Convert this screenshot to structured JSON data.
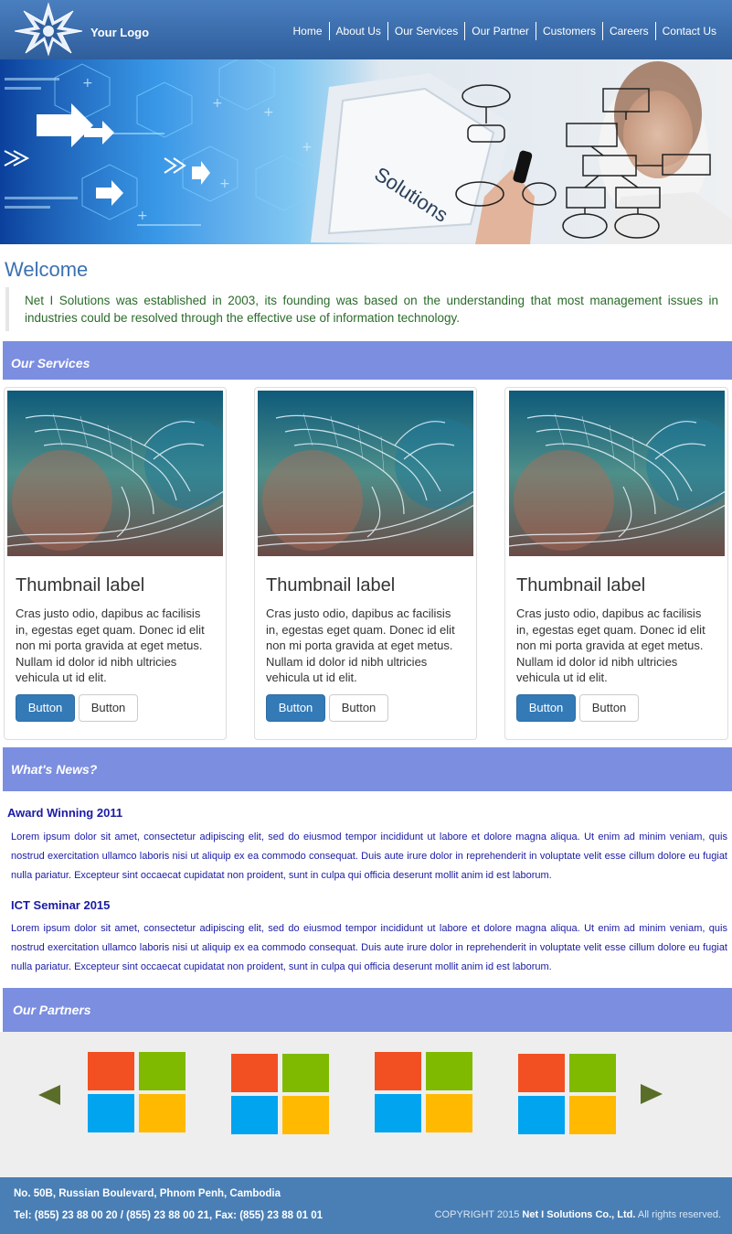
{
  "header": {
    "logo_text": "Your Logo",
    "nav": [
      "Home",
      "About Us",
      "Our Services",
      "Our Partner",
      "Customers",
      "Careers",
      "Contact Us"
    ]
  },
  "banner": {
    "keyboard_key_text": "Solutions"
  },
  "welcome": {
    "title": "Welcome",
    "text": "Net I Solutions was established in 2003, its founding was based on the understanding that most management issues in industries could be resolved through the effective use of information technology."
  },
  "services": {
    "heading": "Our Services",
    "items": [
      {
        "title": "Thumbnail label",
        "desc": "Cras justo odio, dapibus ac facilisis in, egestas eget quam. Donec id elit non mi porta gravida at eget metus. Nullam id dolor id nibh ultricies vehicula ut id elit.",
        "primary": "Button",
        "secondary": "Button"
      },
      {
        "title": "Thumbnail label",
        "desc": "Cras justo odio, dapibus ac facilisis in, egestas eget quam. Donec id elit non mi porta gravida at eget metus. Nullam id dolor id nibh ultricies vehicula ut id elit.",
        "primary": "Button",
        "secondary": "Button"
      },
      {
        "title": "Thumbnail label",
        "desc": "Cras justo odio, dapibus ac facilisis in, egestas eget quam. Donec id elit non mi porta gravida at eget metus. Nullam id dolor id nibh ultricies vehicula ut id elit.",
        "primary": "Button",
        "secondary": "Button"
      }
    ]
  },
  "news": {
    "heading": "What's News?",
    "items": [
      {
        "title": "Award Winning 2011",
        "body": "Lorem ipsum dolor sit amet, consectetur adipiscing elit, sed do eiusmod tempor incididunt ut labore et dolore magna aliqua. Ut enim ad minim veniam, quis nostrud exercitation ullamco laboris nisi ut aliquip ex ea commodo consequat. Duis aute irure dolor in reprehenderit in voluptate velit esse cillum dolore eu fugiat nulla pariatur. Excepteur sint occaecat cupidatat non proident, sunt in culpa qui officia deserunt mollit anim id est laborum."
      },
      {
        "title": "ICT Seminar 2015",
        "body": "Lorem ipsum dolor sit amet, consectetur adipiscing elit, sed do eiusmod tempor incididunt ut labore et dolore magna aliqua. Ut enim ad minim veniam, quis nostrud exercitation ullamco laboris nisi ut aliquip ex ea commodo consequat. Duis aute irure dolor in reprehenderit in voluptate velit esse cillum dolore eu fugiat nulla pariatur. Excepteur sint occaecat cupidatat non proident, sunt in culpa qui officia deserunt mollit anim id est laborum."
      }
    ]
  },
  "partners": {
    "heading": "Our Partners",
    "logo_colors": [
      "#f25022",
      "#7fba00",
      "#00a4ef",
      "#ffb900"
    ],
    "arrow_color": "#5a6e2a"
  },
  "footer": {
    "address": "No. 50B, Russian Boulevard, Phnom Penh, Cambodia",
    "phone": "Tel: (855) 23 88 00 20 / (855) 23 88 00 21, Fax: (855) 23 88 01 01",
    "copyright_prefix": "COPYRIGHT 2015",
    "company": "Net I Solutions Co., Ltd.",
    "rights": "All rights reserved."
  },
  "colors": {
    "header": "#3a6eae",
    "section_bar": "#7b8ee0",
    "footer": "#4a7fb5",
    "welcome_text": "#2a6b2a",
    "news_text": "#1a1aa6"
  }
}
